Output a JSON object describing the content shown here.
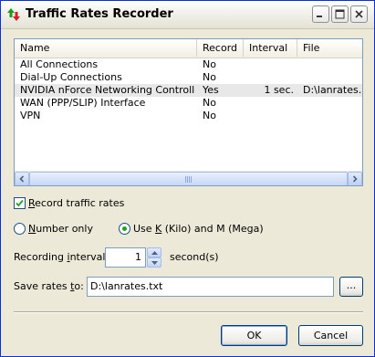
{
  "window": {
    "title": "Traffic Rates Recorder"
  },
  "list": {
    "columns": [
      "Name",
      "Record",
      "Interval",
      "File"
    ],
    "rows": [
      {
        "name": "All Connections",
        "record": "No",
        "interval": "",
        "file": ""
      },
      {
        "name": "Dial-Up Connections",
        "record": "No",
        "interval": "",
        "file": ""
      },
      {
        "name": "NVIDIA nForce Networking Controller",
        "record": "Yes",
        "interval": "1 sec.",
        "file": "D:\\lanrates.txt",
        "selected": true
      },
      {
        "name": "WAN (PPP/SLIP) Interface",
        "record": "No",
        "interval": "",
        "file": ""
      },
      {
        "name": "VPN",
        "record": "No",
        "interval": "",
        "file": ""
      }
    ]
  },
  "record_checkbox": {
    "label_u": "R",
    "label_rest": "ecord traffic rates",
    "checked": true
  },
  "format": {
    "number_only": {
      "label_u": "N",
      "label_rest": "umber only",
      "checked": false
    },
    "kilo_mega": {
      "label_pre": "Use ",
      "label_u": "K",
      "label_rest": " (Kilo) and M (Mega)",
      "checked": true
    }
  },
  "interval": {
    "label_pre": "Recording ",
    "label_u": "i",
    "label_rest": "nterval:",
    "value": "1",
    "unit": "second(s)"
  },
  "save": {
    "label_pre": "Save rates ",
    "label_u": "t",
    "label_rest": "o:",
    "value": "D:\\lanrates.txt",
    "browse_label": "..."
  },
  "buttons": {
    "ok": "OK",
    "cancel": "Cancel"
  },
  "colors": {
    "title_border": "#0831d9",
    "dialog_bg": "#ece9d8",
    "selected_row": "#e8e8e8",
    "accent_green": "#21a121"
  },
  "icons": {
    "app": "up-down-arrows-icon"
  }
}
